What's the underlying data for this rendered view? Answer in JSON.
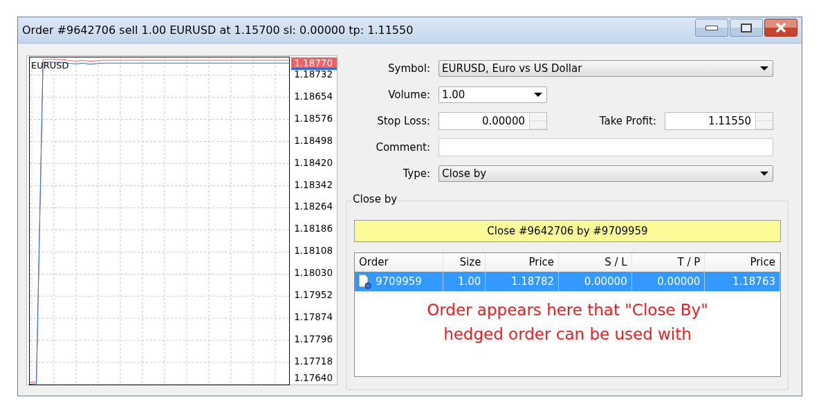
{
  "window": {
    "title": "Order #9642706 sell 1.00 EURUSD at 1.15700 sl: 0.00000 tp: 1.11550"
  },
  "chart": {
    "symbol": "EURUSD",
    "current_price": "1.18770",
    "chart_data": {
      "type": "line",
      "ylim": [
        1.1764,
        1.18795
      ],
      "grid": true,
      "yticks": [
        {
          "value": 1.18732,
          "label": "1.18732"
        },
        {
          "value": 1.18654,
          "label": "1.18654"
        },
        {
          "value": 1.18576,
          "label": "1.18576"
        },
        {
          "value": 1.18498,
          "label": "1.18498"
        },
        {
          "value": 1.1842,
          "label": "1.18420"
        },
        {
          "value": 1.18342,
          "label": "1.18342"
        },
        {
          "value": 1.18264,
          "label": "1.18264"
        },
        {
          "value": 1.18186,
          "label": "1.18186"
        },
        {
          "value": 1.18108,
          "label": "1.18108"
        },
        {
          "value": 1.1803,
          "label": "1.18030"
        },
        {
          "value": 1.17952,
          "label": "1.17952"
        },
        {
          "value": 1.17874,
          "label": "1.17874"
        },
        {
          "value": 1.17796,
          "label": "1.17796"
        },
        {
          "value": 1.17718,
          "label": "1.17718"
        },
        {
          "value": 1.1764,
          "label": "1.17640"
        }
      ],
      "series": [
        {
          "color": "#f06060",
          "values": [
            1.17648,
            1.1765,
            1.18788,
            1.18789,
            1.18788,
            1.18787,
            1.18784,
            1.18782,
            1.18785,
            1.18781,
            1.18783,
            1.18785,
            1.18785,
            1.18785,
            1.18785,
            1.18785,
            1.18785,
            1.18785,
            1.18785,
            1.18785,
            1.18785,
            1.18785,
            1.18785,
            1.18785,
            1.18785,
            1.18785,
            1.18785,
            1.18785,
            1.18785,
            1.18785,
            1.18785,
            1.18785,
            1.18785,
            1.18785,
            1.18785,
            1.18785,
            1.18785,
            1.18785,
            1.18785,
            1.18785
          ]
        },
        {
          "color": "#1f6ff0",
          "values": [
            1.17641,
            1.17643,
            1.18778,
            1.18779,
            1.18778,
            1.18777,
            1.18774,
            1.18772,
            1.18775,
            1.18771,
            1.18773,
            1.18775,
            1.18775,
            1.18775,
            1.18775,
            1.18775,
            1.18775,
            1.18775,
            1.18775,
            1.18775,
            1.18775,
            1.18775,
            1.18775,
            1.18775,
            1.18775,
            1.18775,
            1.18775,
            1.18775,
            1.18775,
            1.18775,
            1.18775,
            1.18775,
            1.18775,
            1.18775,
            1.18775,
            1.18775,
            1.18775,
            1.18775,
            1.18775,
            1.18775
          ]
        }
      ]
    }
  },
  "form": {
    "symbol": {
      "label": "Symbol:",
      "value": "EURUSD, Euro vs US Dollar"
    },
    "volume": {
      "label": "Volume:",
      "value": "1.00"
    },
    "stop_loss": {
      "label": "Stop Loss:",
      "value": "0.00000"
    },
    "take_profit": {
      "label": "Take Profit:",
      "value": "1.11550"
    },
    "comment": {
      "label": "Comment:"
    },
    "type": {
      "label": "Type:",
      "value": "Close by"
    }
  },
  "close_by": {
    "title": "Close by",
    "button": "Close #9642706 by #9709959",
    "columns": [
      "Order",
      "Size",
      "Price",
      "S / L",
      "T / P",
      "Price"
    ],
    "rows": [
      {
        "cells": [
          "9709959",
          "1.00",
          "1.18782",
          "0.00000",
          "0.00000",
          "1.18763"
        ],
        "selected": true
      }
    ],
    "annotation": [
      "Order appears here that \"Close By\"",
      "hedged order can be used with"
    ]
  }
}
